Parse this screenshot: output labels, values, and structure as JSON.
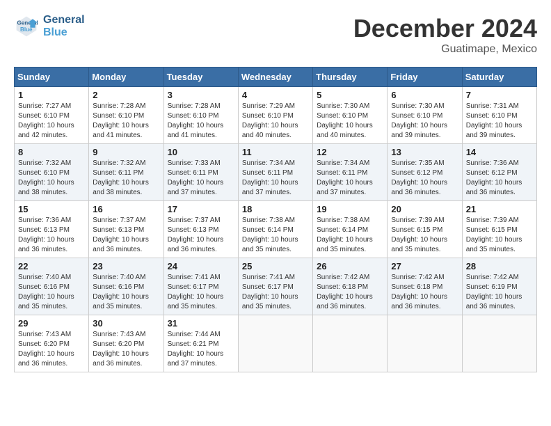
{
  "header": {
    "logo_line1": "General",
    "logo_line2": "Blue",
    "month_title": "December 2024",
    "location": "Guatimape, Mexico"
  },
  "days_of_week": [
    "Sunday",
    "Monday",
    "Tuesday",
    "Wednesday",
    "Thursday",
    "Friday",
    "Saturday"
  ],
  "weeks": [
    [
      {
        "day": "1",
        "sunrise": "7:27 AM",
        "sunset": "6:10 PM",
        "daylight": "10 hours and 42 minutes."
      },
      {
        "day": "2",
        "sunrise": "7:28 AM",
        "sunset": "6:10 PM",
        "daylight": "10 hours and 41 minutes."
      },
      {
        "day": "3",
        "sunrise": "7:28 AM",
        "sunset": "6:10 PM",
        "daylight": "10 hours and 41 minutes."
      },
      {
        "day": "4",
        "sunrise": "7:29 AM",
        "sunset": "6:10 PM",
        "daylight": "10 hours and 40 minutes."
      },
      {
        "day": "5",
        "sunrise": "7:30 AM",
        "sunset": "6:10 PM",
        "daylight": "10 hours and 40 minutes."
      },
      {
        "day": "6",
        "sunrise": "7:30 AM",
        "sunset": "6:10 PM",
        "daylight": "10 hours and 39 minutes."
      },
      {
        "day": "7",
        "sunrise": "7:31 AM",
        "sunset": "6:10 PM",
        "daylight": "10 hours and 39 minutes."
      }
    ],
    [
      {
        "day": "8",
        "sunrise": "7:32 AM",
        "sunset": "6:10 PM",
        "daylight": "10 hours and 38 minutes."
      },
      {
        "day": "9",
        "sunrise": "7:32 AM",
        "sunset": "6:11 PM",
        "daylight": "10 hours and 38 minutes."
      },
      {
        "day": "10",
        "sunrise": "7:33 AM",
        "sunset": "6:11 PM",
        "daylight": "10 hours and 37 minutes."
      },
      {
        "day": "11",
        "sunrise": "7:34 AM",
        "sunset": "6:11 PM",
        "daylight": "10 hours and 37 minutes."
      },
      {
        "day": "12",
        "sunrise": "7:34 AM",
        "sunset": "6:11 PM",
        "daylight": "10 hours and 37 minutes."
      },
      {
        "day": "13",
        "sunrise": "7:35 AM",
        "sunset": "6:12 PM",
        "daylight": "10 hours and 36 minutes."
      },
      {
        "day": "14",
        "sunrise": "7:36 AM",
        "sunset": "6:12 PM",
        "daylight": "10 hours and 36 minutes."
      }
    ],
    [
      {
        "day": "15",
        "sunrise": "7:36 AM",
        "sunset": "6:13 PM",
        "daylight": "10 hours and 36 minutes."
      },
      {
        "day": "16",
        "sunrise": "7:37 AM",
        "sunset": "6:13 PM",
        "daylight": "10 hours and 36 minutes."
      },
      {
        "day": "17",
        "sunrise": "7:37 AM",
        "sunset": "6:13 PM",
        "daylight": "10 hours and 36 minutes."
      },
      {
        "day": "18",
        "sunrise": "7:38 AM",
        "sunset": "6:14 PM",
        "daylight": "10 hours and 35 minutes."
      },
      {
        "day": "19",
        "sunrise": "7:38 AM",
        "sunset": "6:14 PM",
        "daylight": "10 hours and 35 minutes."
      },
      {
        "day": "20",
        "sunrise": "7:39 AM",
        "sunset": "6:15 PM",
        "daylight": "10 hours and 35 minutes."
      },
      {
        "day": "21",
        "sunrise": "7:39 AM",
        "sunset": "6:15 PM",
        "daylight": "10 hours and 35 minutes."
      }
    ],
    [
      {
        "day": "22",
        "sunrise": "7:40 AM",
        "sunset": "6:16 PM",
        "daylight": "10 hours and 35 minutes."
      },
      {
        "day": "23",
        "sunrise": "7:40 AM",
        "sunset": "6:16 PM",
        "daylight": "10 hours and 35 minutes."
      },
      {
        "day": "24",
        "sunrise": "7:41 AM",
        "sunset": "6:17 PM",
        "daylight": "10 hours and 35 minutes."
      },
      {
        "day": "25",
        "sunrise": "7:41 AM",
        "sunset": "6:17 PM",
        "daylight": "10 hours and 35 minutes."
      },
      {
        "day": "26",
        "sunrise": "7:42 AM",
        "sunset": "6:18 PM",
        "daylight": "10 hours and 36 minutes."
      },
      {
        "day": "27",
        "sunrise": "7:42 AM",
        "sunset": "6:18 PM",
        "daylight": "10 hours and 36 minutes."
      },
      {
        "day": "28",
        "sunrise": "7:42 AM",
        "sunset": "6:19 PM",
        "daylight": "10 hours and 36 minutes."
      }
    ],
    [
      {
        "day": "29",
        "sunrise": "7:43 AM",
        "sunset": "6:20 PM",
        "daylight": "10 hours and 36 minutes."
      },
      {
        "day": "30",
        "sunrise": "7:43 AM",
        "sunset": "6:20 PM",
        "daylight": "10 hours and 36 minutes."
      },
      {
        "day": "31",
        "sunrise": "7:44 AM",
        "sunset": "6:21 PM",
        "daylight": "10 hours and 37 minutes."
      },
      null,
      null,
      null,
      null
    ]
  ],
  "labels": {
    "sunrise_label": "Sunrise:",
    "sunset_label": "Sunset:",
    "daylight_label": "Daylight:"
  }
}
